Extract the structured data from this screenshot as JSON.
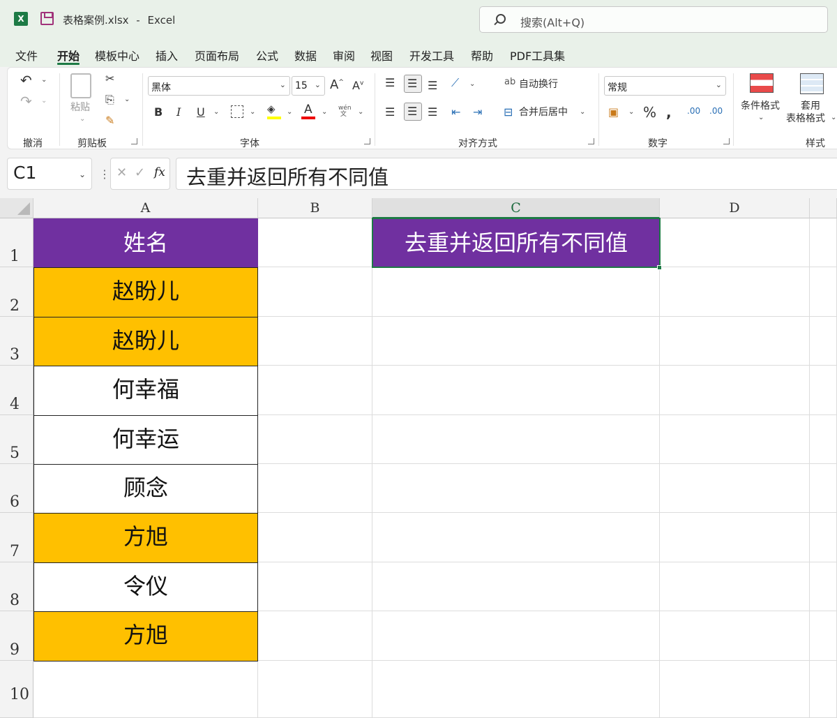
{
  "titlebar": {
    "app_icon": "excel-icon",
    "filename": "表格案例.xlsx",
    "separator": "-",
    "app_name": "Excel",
    "search_placeholder": "搜索(Alt+Q)"
  },
  "menu": {
    "items": [
      "文件",
      "开始",
      "模板中心",
      "插入",
      "页面布局",
      "公式",
      "数据",
      "审阅",
      "视图",
      "开发工具",
      "帮助",
      "PDF工具集"
    ],
    "active": "开始"
  },
  "ribbon": {
    "undo_group": "撤消",
    "clipboard": {
      "label": "剪贴板",
      "paste": "粘贴"
    },
    "font": {
      "label": "字体",
      "name": "黑体",
      "size": "15",
      "bold": "B",
      "italic": "I",
      "underline": "U"
    },
    "alignment": {
      "label": "对齐方式",
      "wrap_text": "自动换行",
      "merge_center": "合并后居中"
    },
    "number": {
      "label": "数字",
      "format": "常规",
      "percent": "%"
    },
    "styles": {
      "label": "样式",
      "conditional": "条件格式",
      "table_format_line1": "套用",
      "table_format_line2": "表格格式"
    }
  },
  "formula_bar": {
    "name_box": "C1",
    "fx": "fx",
    "content": "去重并返回所有不同值"
  },
  "sheet": {
    "columns": [
      "A",
      "B",
      "C",
      "D"
    ],
    "selected_column": "C",
    "rows": [
      "1",
      "2",
      "3",
      "4",
      "5",
      "6",
      "7",
      "8",
      "9",
      "10"
    ],
    "header_cell": "姓名",
    "names": [
      "赵盼儿",
      "赵盼儿",
      "何幸福",
      "何幸运",
      "顾念",
      "方旭",
      "令仪",
      "方旭"
    ],
    "c1_value": "去重并返回所有不同值",
    "colors": {
      "header_fill": "#7030a0",
      "highlight_fill": "#ffc000",
      "selection": "#1d7a45"
    }
  }
}
